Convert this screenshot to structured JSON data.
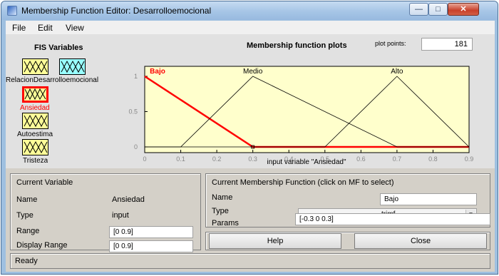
{
  "window": {
    "title": "Membership Function Editor: Desarrolloemocional"
  },
  "menu": [
    "File",
    "Edit",
    "View"
  ],
  "fis": {
    "title": "FIS Variables",
    "inputs": [
      "Relacion",
      "Ansiedad",
      "Autoestima",
      "Tristeza"
    ],
    "output": "Desarrolloemocional",
    "selected": "Ansiedad",
    "overlap_label": "RelacionDesarrolloemocional"
  },
  "plot": {
    "title": "Membership function plots",
    "plot_points_label": "plot points:",
    "plot_points_value": "181"
  },
  "chart_data": {
    "type": "line",
    "title": "",
    "xlabel": "input variable \"Ansiedad\"",
    "ylabel": "",
    "xlim": [
      0,
      0.9
    ],
    "ylim": [
      0,
      1
    ],
    "xticks": [
      "0",
      "0.1",
      "0.2",
      "0.3",
      "0.4",
      "0.5",
      "0.6",
      "0.7",
      "0.8",
      "0.9"
    ],
    "yticks": [
      "0",
      "0.5",
      "1"
    ],
    "series": [
      {
        "name": "Bajo",
        "type": "trimf",
        "params": [
          -0.3,
          0,
          0.3
        ],
        "color": "#ff0000",
        "selected": true
      },
      {
        "name": "Medio",
        "type": "trimf",
        "params": [
          0.1,
          0.3,
          0.7
        ],
        "color": "#000000",
        "selected": false
      },
      {
        "name": "Alto",
        "type": "trimf",
        "params": [
          0.5,
          0.7,
          0.9
        ],
        "color": "#000000",
        "selected": false
      }
    ]
  },
  "current_variable": {
    "title": "Current Variable",
    "name_label": "Name",
    "name_value": "Ansiedad",
    "type_label": "Type",
    "type_value": "input",
    "range_label": "Range",
    "range_value": "[0 0.9]",
    "display_range_label": "Display Range",
    "display_range_value": "[0 0.9]"
  },
  "current_mf": {
    "title": "Current Membership Function (click on MF to select)",
    "name_label": "Name",
    "name_value": "Bajo",
    "type_label": "Type",
    "type_value": "trimf",
    "params_label": "Params",
    "params_value": "[-0.3 0 0.3]"
  },
  "buttons": {
    "help": "Help",
    "close": "Close"
  },
  "status": "Ready",
  "colors": {
    "plot_bg": "#ffffcc",
    "input_box": "#ffff99",
    "output_box": "#99ffff",
    "selected": "#ff0000"
  }
}
